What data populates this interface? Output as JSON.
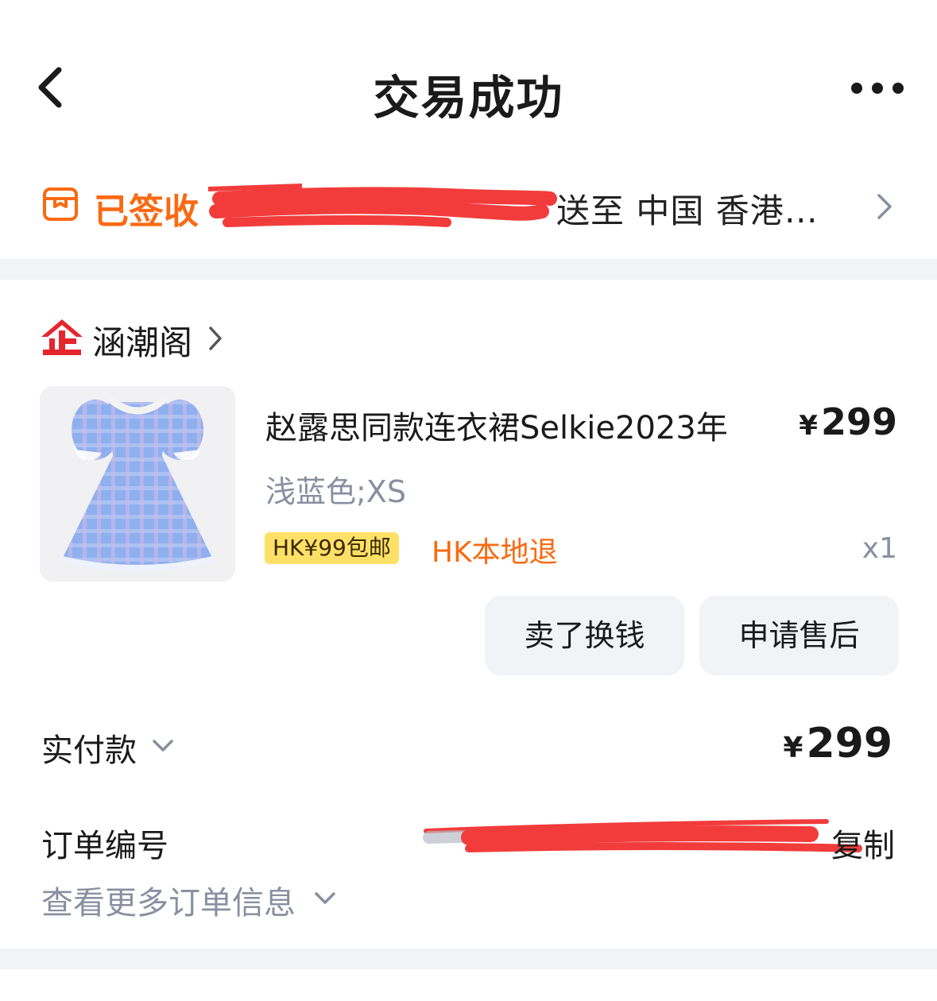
{
  "header": {
    "title": "交易成功",
    "back_icon": "chevron-left-icon",
    "more_icon": "ellipsis-icon"
  },
  "logistics": {
    "status": "已签收",
    "destination": "送至 中国 香港…",
    "status_color": "#f96a12"
  },
  "shop": {
    "name": "涵潮阁",
    "logo_color": "#e5262d"
  },
  "product": {
    "title": "赵露思同款连衣裙Selkie2023年",
    "price_currency": "¥",
    "price_value": "299",
    "spec": "浅蓝色;XS",
    "shipping_tag": "HK¥99包邮",
    "return_tag": "HK本地退",
    "quantity": "x1"
  },
  "actions": {
    "sell_label": "卖了换钱",
    "after_sale_label": "申请售后"
  },
  "payment": {
    "label": "实付款",
    "currency": "¥",
    "amount": "299"
  },
  "order": {
    "number_label": "订单编号",
    "copy_label": "复制",
    "more_info_label": "查看更多订单信息"
  }
}
